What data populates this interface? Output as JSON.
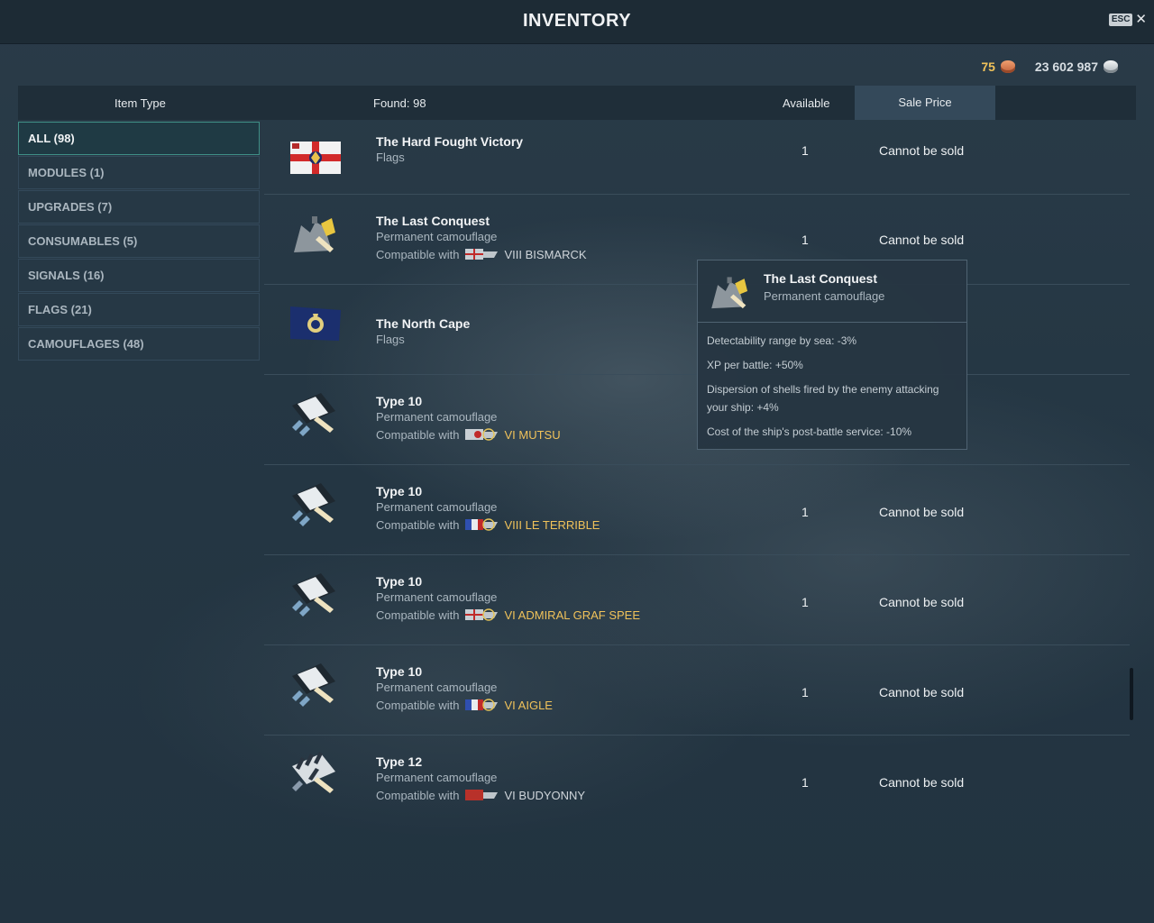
{
  "window": {
    "title": "INVENTORY",
    "esc_label": "ESC"
  },
  "currency": {
    "doubloons": "75",
    "credits": "23 602 987"
  },
  "header": {
    "item_type": "Item Type",
    "found": "Found: 98",
    "available": "Available",
    "sale_price": "Sale Price"
  },
  "filters": [
    {
      "label": "ALL (98)",
      "active": true
    },
    {
      "label": "MODULES (1)"
    },
    {
      "label": "UPGRADES (7)"
    },
    {
      "label": "CONSUMABLES (5)"
    },
    {
      "label": "SIGNALS (16)"
    },
    {
      "label": "FLAGS (21)"
    },
    {
      "label": "CAMOUFLAGES (48)"
    }
  ],
  "items": [
    {
      "name": "The Hard Fought Victory",
      "type": "Flags",
      "available": "1",
      "price": "Cannot be sold",
      "icon": "flag-hard-fought-victory-icon"
    },
    {
      "name": "The Last Conquest",
      "type": "Permanent camouflage",
      "compat_label": "Compatible with",
      "ship": "VIII BISMARCK",
      "available": "1",
      "price": "Cannot be sold",
      "icon": "camo-last-conquest-icon"
    },
    {
      "name": "The North Cape",
      "type": "Flags",
      "icon": "flag-north-cape-icon"
    },
    {
      "name": "Type 10",
      "type": "Permanent camouflage",
      "compat_label": "Compatible with",
      "ship": "VI MUTSU",
      "icon": "camo-type-10-icon"
    },
    {
      "name": "Type 10",
      "type": "Permanent camouflage",
      "compat_label": "Compatible with",
      "ship": "VIII LE TERRIBLE",
      "available": "1",
      "price": "Cannot be sold",
      "icon": "camo-type-10-icon"
    },
    {
      "name": "Type 10",
      "type": "Permanent camouflage",
      "compat_label": "Compatible with",
      "ship": "VI ADMIRAL GRAF SPEE",
      "available": "1",
      "price": "Cannot be sold",
      "icon": "camo-type-10-icon"
    },
    {
      "name": "Type 10",
      "type": "Permanent camouflage",
      "compat_label": "Compatible with",
      "ship": "VI AIGLE",
      "available": "1",
      "price": "Cannot be sold",
      "icon": "camo-type-10-icon"
    },
    {
      "name": "Type 12",
      "type": "Permanent camouflage",
      "compat_label": "Compatible with",
      "ship": "VI BUDYONNY",
      "available": "1",
      "price": "Cannot be sold",
      "icon": "camo-type-12-icon"
    }
  ],
  "tooltip": {
    "title": "The Last Conquest",
    "subtitle": "Permanent camouflage",
    "lines": [
      "Detectability range by sea: -3%",
      "XP per battle: +50%",
      "Dispersion of shells fired by the enemy attacking your ship: +4%",
      "Cost of the ship's post-battle service: -10%"
    ]
  },
  "colors": {
    "accent_gold": "#f0c25a",
    "active_border": "#3f8f86",
    "background": "#253744"
  }
}
